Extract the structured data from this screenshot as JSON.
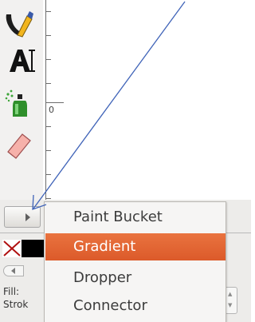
{
  "ruler": {
    "label": "0"
  },
  "tools": [
    {
      "name": "calligraphy-tool",
      "icon": "calligraphy-pen-icon"
    },
    {
      "name": "text-tool",
      "icon": "text-icon"
    },
    {
      "name": "spray-tool",
      "icon": "spray-can-icon"
    },
    {
      "name": "eraser-tool",
      "icon": "eraser-icon"
    }
  ],
  "flyout_button": {
    "icon": "triangle-right-icon"
  },
  "menu": {
    "items": [
      {
        "label": "Paint Bucket",
        "highlighted": false
      },
      {
        "label": "Gradient",
        "highlighted": true
      },
      {
        "label": "Dropper",
        "highlighted": false
      },
      {
        "label": "Connector",
        "highlighted": false
      }
    ]
  },
  "palette": {
    "no_color_icon": "x-icon",
    "swatch_color": "#000000"
  },
  "status": {
    "fill_label": "Fill:",
    "stroke_label": "Strok"
  },
  "colors": {
    "highlight": "#e06030",
    "arrow": "#3f63b8"
  }
}
